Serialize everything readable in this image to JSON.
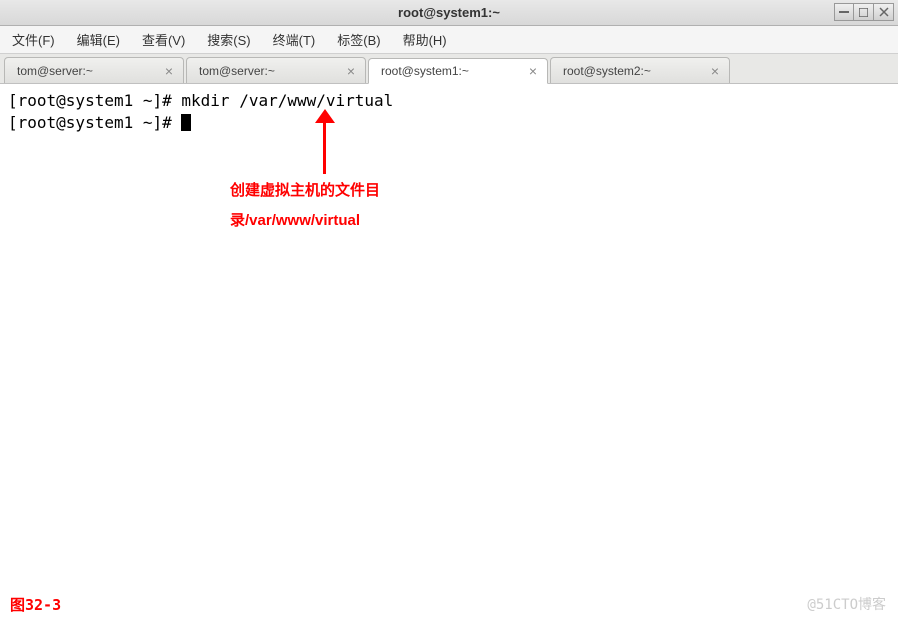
{
  "window": {
    "title": "root@system1:~"
  },
  "menu": {
    "file": "文件(F)",
    "edit": "编辑(E)",
    "view": "查看(V)",
    "search": "搜索(S)",
    "terminal": "终端(T)",
    "tabs": "标签(B)",
    "help": "帮助(H)"
  },
  "tabs": [
    {
      "label": "tom@server:~",
      "active": false
    },
    {
      "label": "tom@server:~",
      "active": false
    },
    {
      "label": "root@system1:~",
      "active": true
    },
    {
      "label": "root@system2:~",
      "active": false
    }
  ],
  "terminal": {
    "lines": [
      "[root@system1 ~]# mkdir /var/www/virtual",
      "[root@system1 ~]# "
    ]
  },
  "annotation": {
    "line1": "创建虚拟主机的文件目",
    "line2": "录/var/www/virtual"
  },
  "figure_label": "图32-3",
  "watermark": "@51CTO博客"
}
